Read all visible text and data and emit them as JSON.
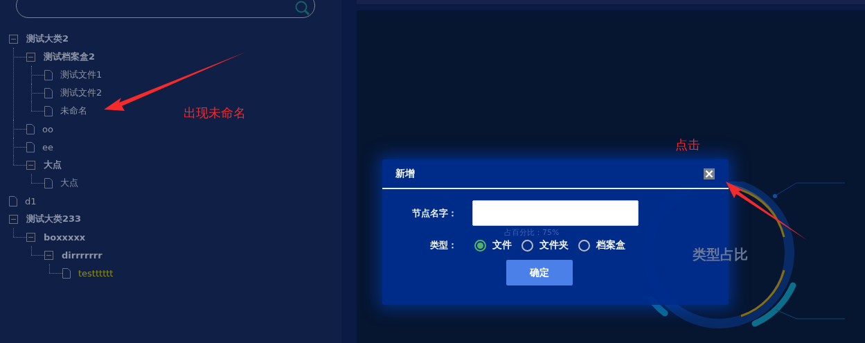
{
  "sidebar": {
    "tree": [
      {
        "label": "测试大类2",
        "kind": "folder",
        "selected": false,
        "children": [
          {
            "label": "测试档案盒2",
            "kind": "folder",
            "selected": false,
            "children": [
              {
                "label": "测试文件1",
                "kind": "file",
                "selected": false
              },
              {
                "label": "测试文件2",
                "kind": "file",
                "selected": false
              },
              {
                "label": "未命名",
                "kind": "file",
                "selected": false
              }
            ]
          },
          {
            "label": "oo",
            "kind": "file",
            "selected": false
          },
          {
            "label": "ee",
            "kind": "file",
            "selected": false
          },
          {
            "label": "大点",
            "kind": "folder",
            "selected": false,
            "children": [
              {
                "label": "大点",
                "kind": "file",
                "selected": false
              }
            ]
          }
        ]
      },
      {
        "label": "d1",
        "kind": "file",
        "selected": false
      },
      {
        "label": "测试大类233",
        "kind": "folder",
        "selected": false,
        "children": [
          {
            "label": "boxxxxx",
            "kind": "folder",
            "selected": false,
            "children": [
              {
                "label": "dirrrrrrr",
                "kind": "folder",
                "selected": false,
                "children": [
                  {
                    "label": "testttttt",
                    "kind": "file",
                    "selected": true
                  }
                ]
              }
            ]
          }
        ]
      }
    ]
  },
  "background_chart": {
    "percent_label": "占百分比：75%",
    "title": "类型占比"
  },
  "dialog": {
    "title": "新增",
    "name_label": "节点名字：",
    "type_label": "类型：",
    "type_options": [
      {
        "label": "文件",
        "selected": true
      },
      {
        "label": "文件夹",
        "selected": false
      },
      {
        "label": "档案盒",
        "selected": false
      }
    ],
    "submit": "确定"
  },
  "annotations": [
    {
      "text": "出现未命名"
    },
    {
      "text": "点击"
    }
  ]
}
